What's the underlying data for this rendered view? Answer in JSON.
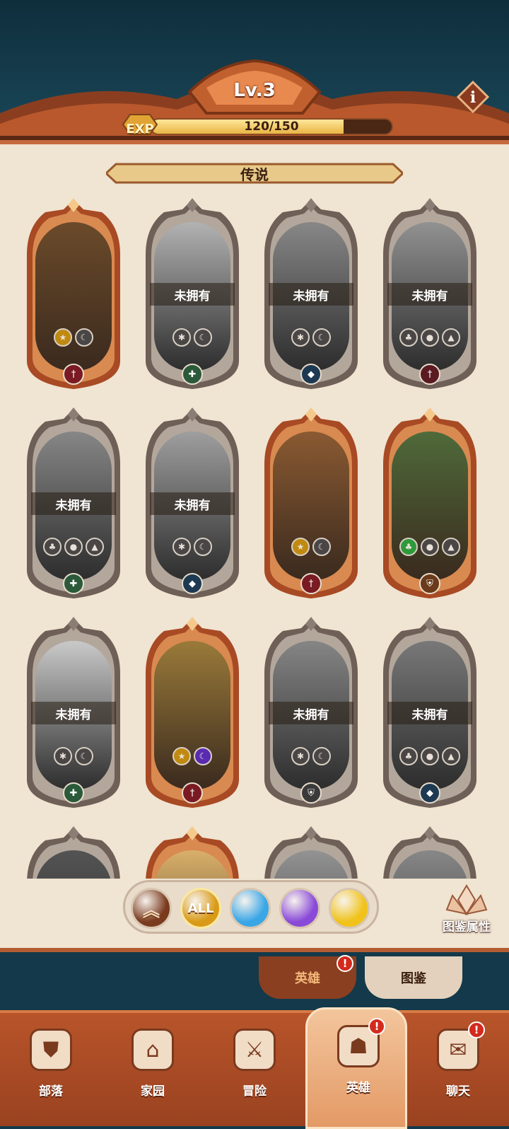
{
  "header": {
    "level": "Lv.3",
    "exp_icon": "EXP",
    "exp_text": "120/150",
    "exp_fraction": 0.8,
    "info_icon": "i"
  },
  "section": {
    "title": "传说"
  },
  "cards": [
    {
      "status": "",
      "owned": true,
      "frame": "orange",
      "badges": [
        "star",
        "moon"
      ],
      "class_icon": "sword",
      "class_color": "#7a1a22",
      "portrait": "#6b4a2a"
    },
    {
      "status": "未拥有",
      "owned": false,
      "frame": "gray",
      "badges": [
        "snow",
        "moon"
      ],
      "class_icon": "heal",
      "class_color": "#2a5a3a",
      "portrait": "#b9b1a6"
    },
    {
      "status": "未拥有",
      "owned": false,
      "frame": "gray",
      "badges": [
        "snow",
        "moon"
      ],
      "class_icon": "magic",
      "class_color": "#1d3a52",
      "portrait": "#8d867a"
    },
    {
      "status": "未拥有",
      "owned": false,
      "frame": "gray",
      "badges": [
        "leaf",
        "drop",
        "fire"
      ],
      "class_icon": "sword",
      "class_color": "#5a1a22",
      "portrait": "#9a8f86"
    },
    {
      "status": "未拥有",
      "owned": false,
      "frame": "gray",
      "badges": [
        "leaf",
        "drop",
        "fire"
      ],
      "class_icon": "heal",
      "class_color": "#2a5a3a",
      "portrait": "#8e857a"
    },
    {
      "status": "未拥有",
      "owned": false,
      "frame": "gray",
      "badges": [
        "snow",
        "moon"
      ],
      "class_icon": "magic",
      "class_color": "#1d3a52",
      "portrait": "#a59d90"
    },
    {
      "status": "",
      "owned": true,
      "frame": "orange",
      "badges": [
        "star",
        "moon"
      ],
      "class_icon": "sword",
      "class_color": "#7a1a22",
      "portrait": "#8a5a32"
    },
    {
      "status": "",
      "owned": true,
      "frame": "orange",
      "badges": [
        "leaf",
        "drop",
        "fire"
      ],
      "class_icon": "shield",
      "class_color": "#6a3a1a",
      "portrait": "#4f6a3a"
    },
    {
      "status": "未拥有",
      "owned": false,
      "frame": "gray",
      "badges": [
        "snow",
        "moon"
      ],
      "class_icon": "heal",
      "class_color": "#2a5a3a",
      "portrait": "#cfc8be"
    },
    {
      "status": "",
      "owned": true,
      "frame": "orange",
      "badges": [
        "star",
        "moon"
      ],
      "class_icon": "sword",
      "class_color": "#7a1a22",
      "portrait": "#9a7a3a"
    },
    {
      "status": "未拥有",
      "owned": false,
      "frame": "gray",
      "badges": [
        "snow",
        "moon"
      ],
      "class_icon": "shield",
      "class_color": "#3a3a3a",
      "portrait": "#8a847a"
    },
    {
      "status": "未拥有",
      "owned": false,
      "frame": "gray",
      "badges": [
        "leaf",
        "drop",
        "fire"
      ],
      "class_icon": "magic",
      "class_color": "#1d3a52",
      "portrait": "#7e776c"
    },
    {
      "status": "",
      "owned": false,
      "frame": "gray",
      "badges": [],
      "class_icon": "",
      "class_color": "#3a3a3a",
      "portrait": "#5a5249"
    },
    {
      "status": "",
      "owned": true,
      "frame": "orange",
      "badges": [],
      "class_icon": "",
      "class_color": "#3a3a3a",
      "portrait": "#d9b06a"
    },
    {
      "status": "",
      "owned": false,
      "frame": "gray",
      "badges": [],
      "class_icon": "",
      "class_color": "#3a3a3a",
      "portrait": "#9a928a"
    },
    {
      "status": "",
      "owned": false,
      "frame": "gray",
      "badges": [],
      "class_icon": "",
      "class_color": "#3a3a3a",
      "portrait": "#8e867c"
    }
  ],
  "filters": [
    {
      "name": "collapse",
      "label": "",
      "icon": "chevron-up-double-icon",
      "color": "#7a3a1e"
    },
    {
      "name": "all",
      "label": "ALL",
      "icon": "all-icon",
      "color": "#d99a18"
    },
    {
      "name": "blue",
      "label": "",
      "icon": "blue-gem-icon",
      "color": "#3aa6e6"
    },
    {
      "name": "purple",
      "label": "",
      "icon": "purple-gem-icon",
      "color": "#8a4ad8"
    },
    {
      "name": "gold",
      "label": "",
      "icon": "gold-gem-icon",
      "color": "#f0c21a"
    }
  ],
  "attr_button": {
    "label": "图鉴属性",
    "icon": "lotus-icon"
  },
  "subtabs": [
    {
      "label": "英雄",
      "alert": "!"
    },
    {
      "label": "图鉴"
    }
  ],
  "nav": [
    {
      "label": "部落",
      "icon": "tribe-banner-icon"
    },
    {
      "label": "家园",
      "icon": "home-icon"
    },
    {
      "label": "冒险",
      "icon": "crossed-swords-icon"
    },
    {
      "label": "英雄",
      "icon": "viking-helmet-icon",
      "alert": "!",
      "active": true
    },
    {
      "label": "聊天",
      "icon": "chat-bubble-icon",
      "alert": "!"
    }
  ]
}
